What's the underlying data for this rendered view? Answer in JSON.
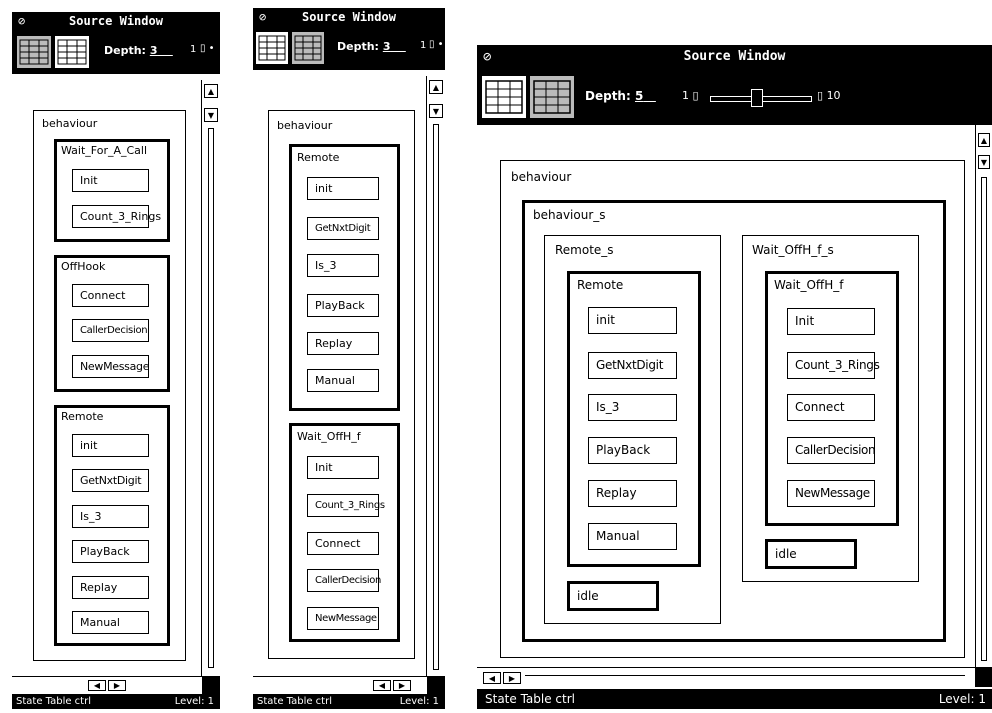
{
  "windows": [
    {
      "title": "Source Window",
      "depth_label": "Depth:",
      "depth_value": "3",
      "slider_min": "1",
      "status_left": "State Table ctrl",
      "status_right": "Level: 1",
      "diagram": {
        "root": "behaviour",
        "groups": [
          {
            "label": "Wait_For_A_Call",
            "states": [
              "Init",
              "Count_3_Rings"
            ]
          },
          {
            "label": "OffHook",
            "states": [
              "Connect",
              "CallerDecision",
              "NewMessage"
            ]
          },
          {
            "label": "Remote",
            "states": [
              "init",
              "GetNxtDigit",
              "Is_3",
              "PlayBack",
              "Replay",
              "Manual"
            ]
          }
        ]
      }
    },
    {
      "title": "Source Window",
      "depth_label": "Depth:",
      "depth_value": "3",
      "slider_min": "1",
      "status_left": "State Table ctrl",
      "status_right": "Level: 1",
      "diagram": {
        "root": "behaviour",
        "groups": [
          {
            "label": "Remote",
            "states": [
              "init",
              "GetNxtDigit",
              "Is_3",
              "PlayBack",
              "Replay",
              "Manual"
            ]
          },
          {
            "label": "Wait_OffH_f",
            "states": [
              "Init",
              "Count_3_Rings",
              "Connect",
              "CallerDecision",
              "NewMessage"
            ]
          }
        ]
      }
    },
    {
      "title": "Source Window",
      "depth_label": "Depth:",
      "depth_value": "5",
      "slider_min": "1",
      "slider_max": "10",
      "slider_level": 0.45,
      "status_left": "State Table ctrl",
      "status_right": "Level: 1",
      "diagram": {
        "root": "behaviour",
        "inner": "behaviour_s",
        "left": {
          "label": "Remote_s",
          "group": "Remote",
          "states": [
            "init",
            "GetNxtDigit",
            "Is_3",
            "PlayBack",
            "Replay",
            "Manual"
          ],
          "idle": "idle"
        },
        "right": {
          "label": "Wait_OffH_f_s",
          "group": "Wait_OffH_f",
          "states": [
            "Init",
            "Count_3_Rings",
            "Connect",
            "CallerDecision",
            "NewMessage"
          ],
          "idle": "idle"
        }
      }
    }
  ]
}
